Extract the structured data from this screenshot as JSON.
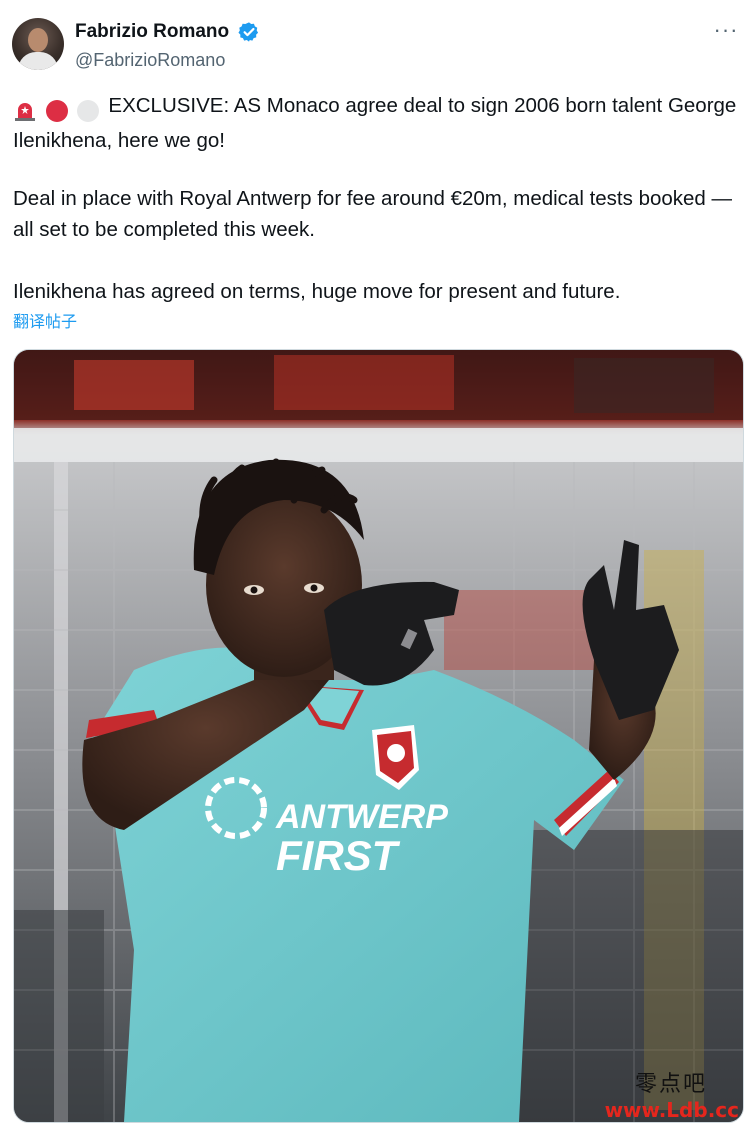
{
  "author": {
    "display_name": "Fabrizio Romano",
    "handle": "@FabrizioRomano",
    "verified": true
  },
  "colors": {
    "verified": "#1d9bf0",
    "link": "#1d9bf0",
    "text": "#0f1419",
    "secondary": "#536471",
    "watermark_url": "#e5261d"
  },
  "tweet": {
    "emojis": [
      "rotating-light-icon",
      "red-circle-icon",
      "white-circle-icon"
    ],
    "line1": "EXCLUSIVE: AS Monaco agree deal to sign 2006 born talent George Ilenikhena, here we go!",
    "line2": "Deal in place with Royal Antwerp for fee around €20m, medical tests booked — all set to be completed this week.",
    "line3": "Ilenikhena has agreed on terms, huge move for present and future.",
    "translate_label": "翻译帖子"
  },
  "media": {
    "jersey_sponsor_line1": "ANTWERP",
    "jersey_sponsor_line2": "FIRST",
    "watermark_text": "零点吧",
    "watermark_url": "www.Ldb.cc"
  }
}
